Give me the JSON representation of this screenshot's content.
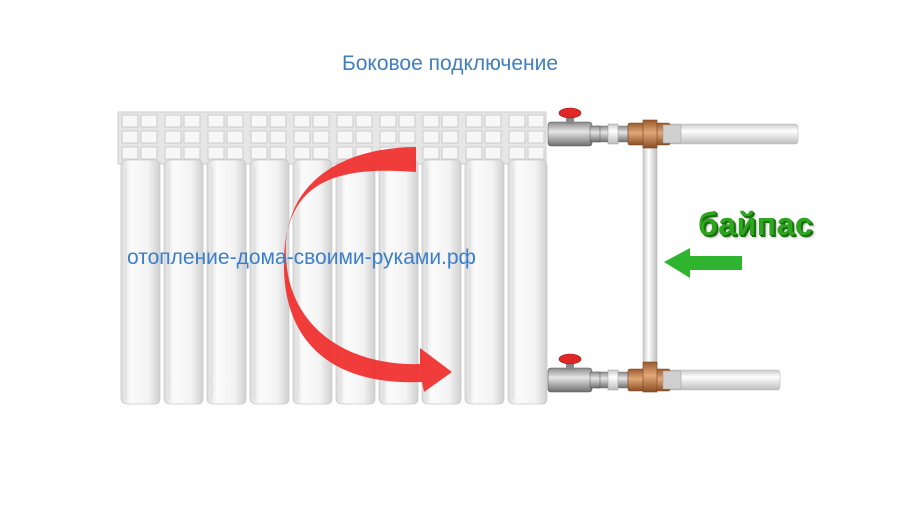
{
  "title": "Боковое подключение",
  "watermark": "отопление-дома-своими-руками.рф",
  "bypass_label": "байпас",
  "colors": {
    "title": "#3f7fc0",
    "watermark": "#3a7fcc",
    "bypass_text": "#2ea51f",
    "flow_arrow": "#f03232",
    "bypass_arrow": "#2eb42e",
    "valve_handle": "#e02828",
    "fitting_brass": "#c98a52",
    "pipe": "#e8e8e8"
  },
  "icons": [
    "flow-direction-arrow",
    "bypass-direction-arrow",
    "radiator",
    "valve",
    "tee-fitting"
  ]
}
